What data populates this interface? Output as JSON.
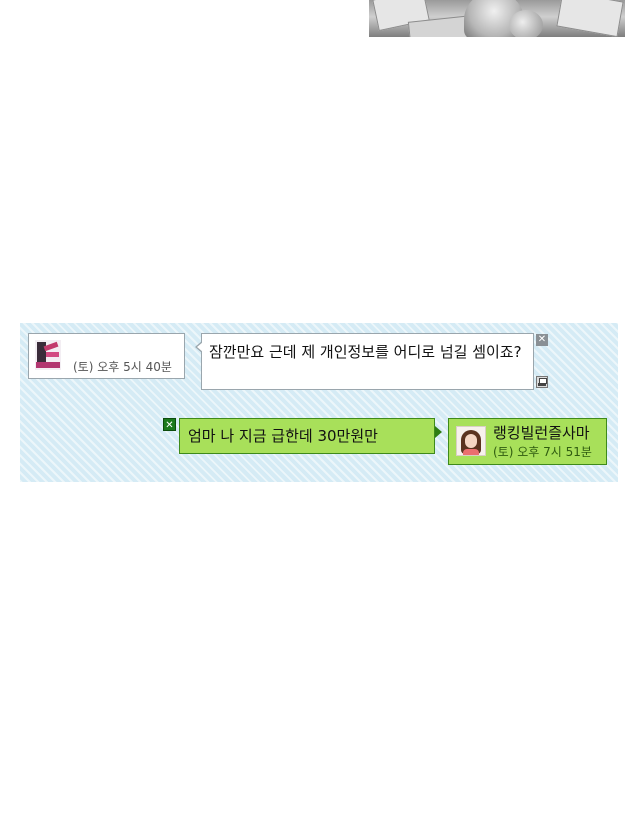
{
  "chat": {
    "incoming": {
      "avatar_icon": "profile-photo",
      "time": "(토) 오후 5시 40분",
      "message": "잠깐만요 근데 제 개인정보를 어디로 넘길 셈이죠?",
      "close_symbol": "✕",
      "print_icon": "printer-icon"
    },
    "outgoing": {
      "message": "엄마 나 지금 급한데 30만원만",
      "close_symbol": "✕",
      "sender_name": "랭킹빌런즐사마",
      "avatar_icon": "profile-photo",
      "time": "(토) 오후 7시 51분"
    }
  },
  "colors": {
    "panel_background": "#d5ebf5",
    "outgoing_bubble": "#a8e05a",
    "outgoing_border": "#3f8a1a",
    "incoming_bubble": "#ffffff"
  }
}
